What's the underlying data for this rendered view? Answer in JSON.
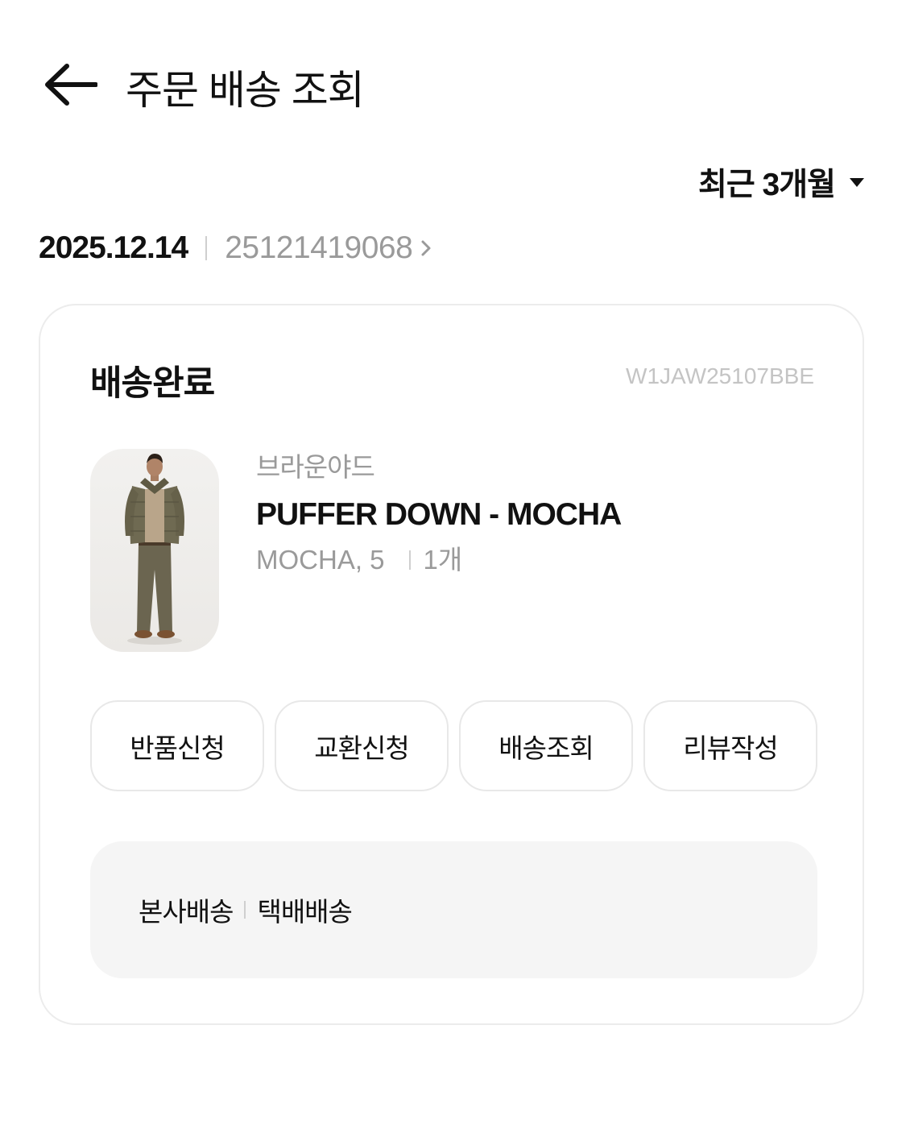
{
  "header": {
    "title": "주문 배송 조회",
    "back_icon": "arrow-left-icon"
  },
  "filter": {
    "period_label": "최근 3개월",
    "caret_icon": "caret-down-icon"
  },
  "order": {
    "date": "2025.12.14",
    "number": "25121419068",
    "chevron_icon": "chevron-right-icon"
  },
  "card": {
    "status": "배송완료",
    "product_code": "W1JAW25107BBE",
    "product": {
      "brand": "브라운야드",
      "name": "PUFFER DOWN - MOCHA",
      "option": "MOCHA, 5",
      "quantity": "1개"
    },
    "actions": [
      {
        "label": "반품신청"
      },
      {
        "label": "교환신청"
      },
      {
        "label": "배송조회"
      },
      {
        "label": "리뷰작성"
      }
    ],
    "delivery": {
      "type": "본사배송",
      "method": "택배배송"
    }
  },
  "colors": {
    "text_primary": "#111111",
    "text_secondary": "#9a9a9a",
    "text_muted": "#c4c4c4",
    "border": "#ececec",
    "panel_bg": "#f5f5f5"
  }
}
